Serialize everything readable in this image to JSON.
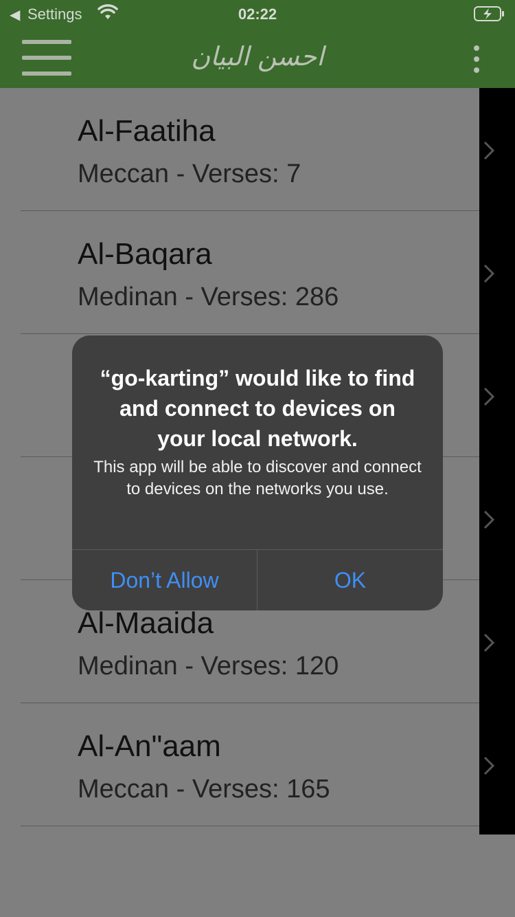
{
  "status_bar": {
    "back_label": "Settings",
    "time": "02:22"
  },
  "app_bar": {
    "title": "احسن البیان"
  },
  "surahs": [
    {
      "name": "Al-Faatiha",
      "meta": "Meccan - Verses: 7"
    },
    {
      "name": "Al-Baqara",
      "meta": "Medinan - Verses: 286"
    },
    {
      "name": "",
      "meta": ""
    },
    {
      "name": "",
      "meta": ""
    },
    {
      "name": "Al-Maaida",
      "meta": "Medinan - Verses: 120"
    },
    {
      "name": "Al-An\"aam",
      "meta": "Meccan - Verses: 165"
    }
  ],
  "alert": {
    "title": "“go-karting” would like to find and connect to devices on your local network.",
    "message": "This app will be able to discover and connect to devices on the networks you use.",
    "deny_label": "Don’t Allow",
    "ok_label": "OK"
  },
  "colors": {
    "app_bar": "#3a6a2c",
    "alert_bg": "#3f3f3f",
    "alert_button": "#3f8ff5"
  },
  "icons": [
    "back-arrow-icon",
    "wifi-icon",
    "battery-icon",
    "hamburger-menu-icon",
    "more-vertical-icon",
    "chevron-right-icon"
  ]
}
